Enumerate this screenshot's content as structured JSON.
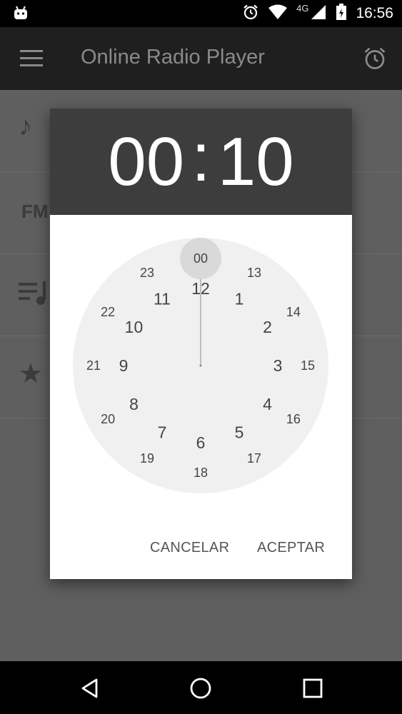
{
  "status_bar": {
    "time": "16:56",
    "network": "4G",
    "icons": [
      "android-icon",
      "alarm-icon",
      "wifi-icon",
      "signal-icon",
      "battery-icon"
    ]
  },
  "app_bar": {
    "title": "Online Radio Player",
    "left_icon": "menu-icon",
    "right_icon": "alarm-icon"
  },
  "background_list": {
    "rows": [
      {
        "icon": "music-note-icon",
        "text": ""
      },
      {
        "icon": "",
        "text": "FM"
      },
      {
        "icon": "playlist-icon",
        "text": ""
      },
      {
        "icon": "star-icon",
        "text": ""
      }
    ]
  },
  "time_picker": {
    "hours": "00",
    "separator": ":",
    "minutes": "10",
    "selected_hour": "00",
    "outer_hours": [
      "12",
      "1",
      "2",
      "3",
      "4",
      "5",
      "6",
      "7",
      "8",
      "9",
      "10",
      "11"
    ],
    "inner_hours": [
      "00",
      "13",
      "14",
      "15",
      "16",
      "17",
      "18",
      "19",
      "20",
      "21",
      "22",
      "23"
    ],
    "cancel_label": "CANCELAR",
    "accept_label": "ACEPTAR"
  },
  "colors": {
    "dialog_header": "#3d3d3d",
    "clock_face": "#f1f0f1",
    "selector": "#d9d9d9",
    "hand": "#8a8a8a"
  },
  "nav_bar": {
    "icons": [
      "back-icon",
      "home-icon",
      "recents-icon"
    ]
  }
}
